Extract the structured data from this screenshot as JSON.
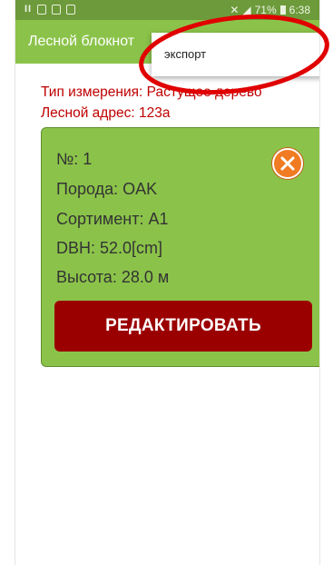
{
  "status_bar": {
    "battery": "71%",
    "time": "6:38",
    "icons": [
      "pause-icon",
      "bag-icon",
      "image-icon",
      "file-icon",
      "mute-icon",
      "signal-icon",
      "battery-icon"
    ]
  },
  "toolbar": {
    "title": "Лесной блокнот"
  },
  "menu": {
    "export_label": "экспорт"
  },
  "info": {
    "measurement_type": "Тип измерения: Растущее дерево",
    "forest_address": "Лесной адрес: 123а"
  },
  "card": {
    "number": "№: 1",
    "species": "Порода: OAK",
    "assortment": "Сортимент: A1",
    "dbh": "DBH: 52.0[cm]",
    "height": "Высота: 28.0 м",
    "edit_label": "РЕДАКТИРОВАТЬ"
  },
  "colors": {
    "toolbar": "#8bc34a",
    "status_bar": "#6d9a3a",
    "info_text": "#c00000",
    "card_bg": "#8bc34a",
    "edit_button": "#9b0000",
    "close_button": "#f07b22",
    "annotation": "#e00000"
  }
}
